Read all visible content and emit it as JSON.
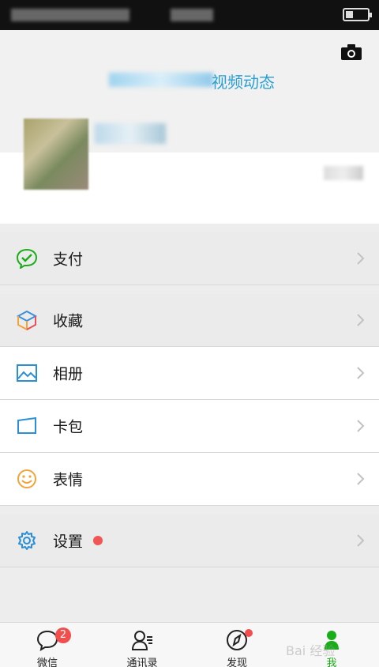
{
  "profile": {
    "feed_label": "视频动态"
  },
  "menu": {
    "pay": "支付",
    "favorites": "收藏",
    "album": "相册",
    "cards": "卡包",
    "stickers": "表情",
    "settings": "设置"
  },
  "tabs": {
    "chats": "微信",
    "chats_badge": "2",
    "contacts": "通讯录",
    "discover": "发现",
    "me": "我"
  },
  "watermark": "Bai 经验",
  "colors": {
    "accent_green": "#1aad19",
    "link_blue": "#2a9fd6",
    "badge_red": "#f24e4e"
  }
}
